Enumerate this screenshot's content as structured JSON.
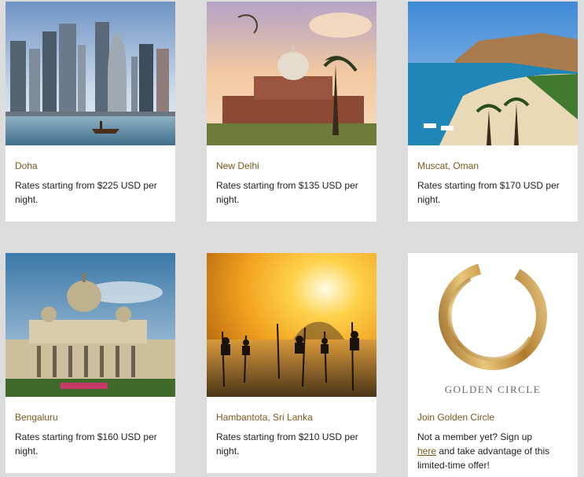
{
  "cards": [
    {
      "title": "Doha",
      "description": "Rates starting from $225 USD per night.",
      "image": "doha-skyline-photo"
    },
    {
      "title": "New Delhi",
      "description": "Rates starting from $135 USD per night.",
      "image": "humayun-tomb-photo"
    },
    {
      "title": "Muscat, Oman",
      "description": "Rates starting from $170 USD per night.",
      "image": "muscat-beach-photo"
    },
    {
      "title": "Bengaluru",
      "description": "Rates starting from $160 USD per night.",
      "image": "vidhana-soudha-photo"
    },
    {
      "title": "Hambantota, Sri Lanka",
      "description": "Rates starting from $210 USD per night.",
      "image": "stilt-fishermen-photo"
    },
    {
      "title": "Join Golden Circle",
      "description_before": "Not a member yet? Sign up",
      "link_text": "here",
      "description_after": "and take advantage of this limited-time offer!",
      "image": "golden-circle-logo",
      "logo_text": "GOLDEN CIRCLE"
    }
  ],
  "colors": {
    "page_bg": "#dcdcdc",
    "card_bg": "#ffffff",
    "title": "#7a5a1e",
    "text": "#222222",
    "gold": "#c79a45"
  }
}
